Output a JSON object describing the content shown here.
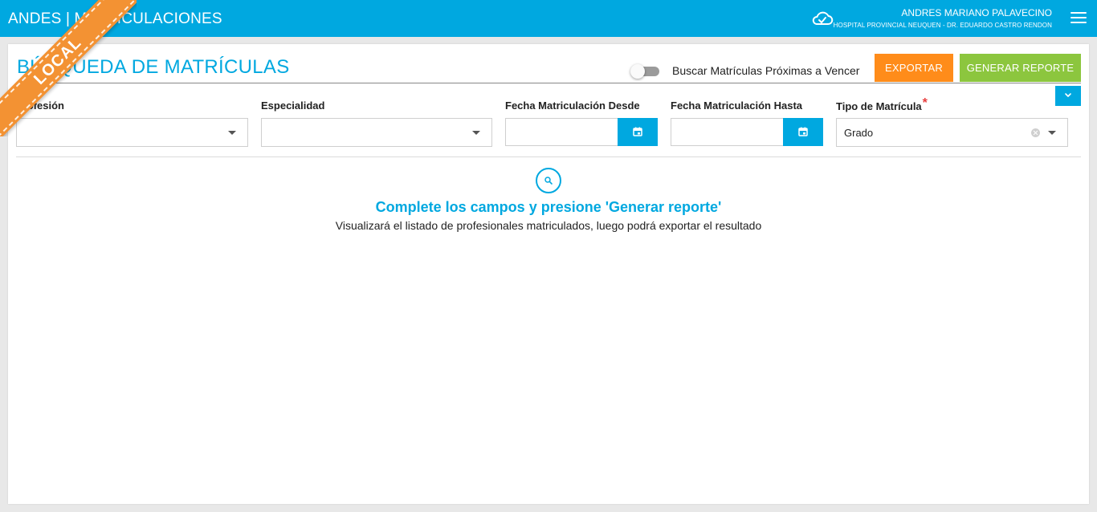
{
  "header": {
    "app_title": "ANDES | MATRICULACIONES",
    "user_name": "ANDRES MARIANO PALAVECINO",
    "user_org": "HOSPITAL PROVINCIAL NEUQUEN - DR. EDUARDO CASTRO RENDON",
    "cloud_icon": "cloud-check-icon",
    "menu_icon": "hamburger-menu-icon"
  },
  "environment_ribbon": "LOCAL",
  "page": {
    "title": "BÚSQUEDA DE MATRÍCULAS",
    "toggle_label": "Buscar Matrículas Próximas a Vencer",
    "toggle_on": false,
    "export_label": "EXPORTAR",
    "report_label": "GENERAR REPORTE"
  },
  "filters": {
    "profesion": {
      "label": "Profesión",
      "value": ""
    },
    "especialidad": {
      "label": "Especialidad",
      "value": ""
    },
    "fecha_desde": {
      "label": "Fecha Matriculación Desde",
      "value": ""
    },
    "fecha_hasta": {
      "label": "Fecha Matriculación Hasta",
      "value": ""
    },
    "tipo_matricula": {
      "label": "Tipo de Matrícula",
      "required_mark": "*",
      "value": "Grado"
    }
  },
  "empty_state": {
    "title": "Complete los campos y presione 'Generar reporte'",
    "subtitle": "Visualizará el listado de profesionales matriculados, luego podrá exportar el resultado"
  },
  "colors": {
    "primary": "#00a8e0",
    "export": "#ff8c1a",
    "report": "#8cc63e",
    "ribbon": "#f39233",
    "required": "#e83e3e"
  }
}
